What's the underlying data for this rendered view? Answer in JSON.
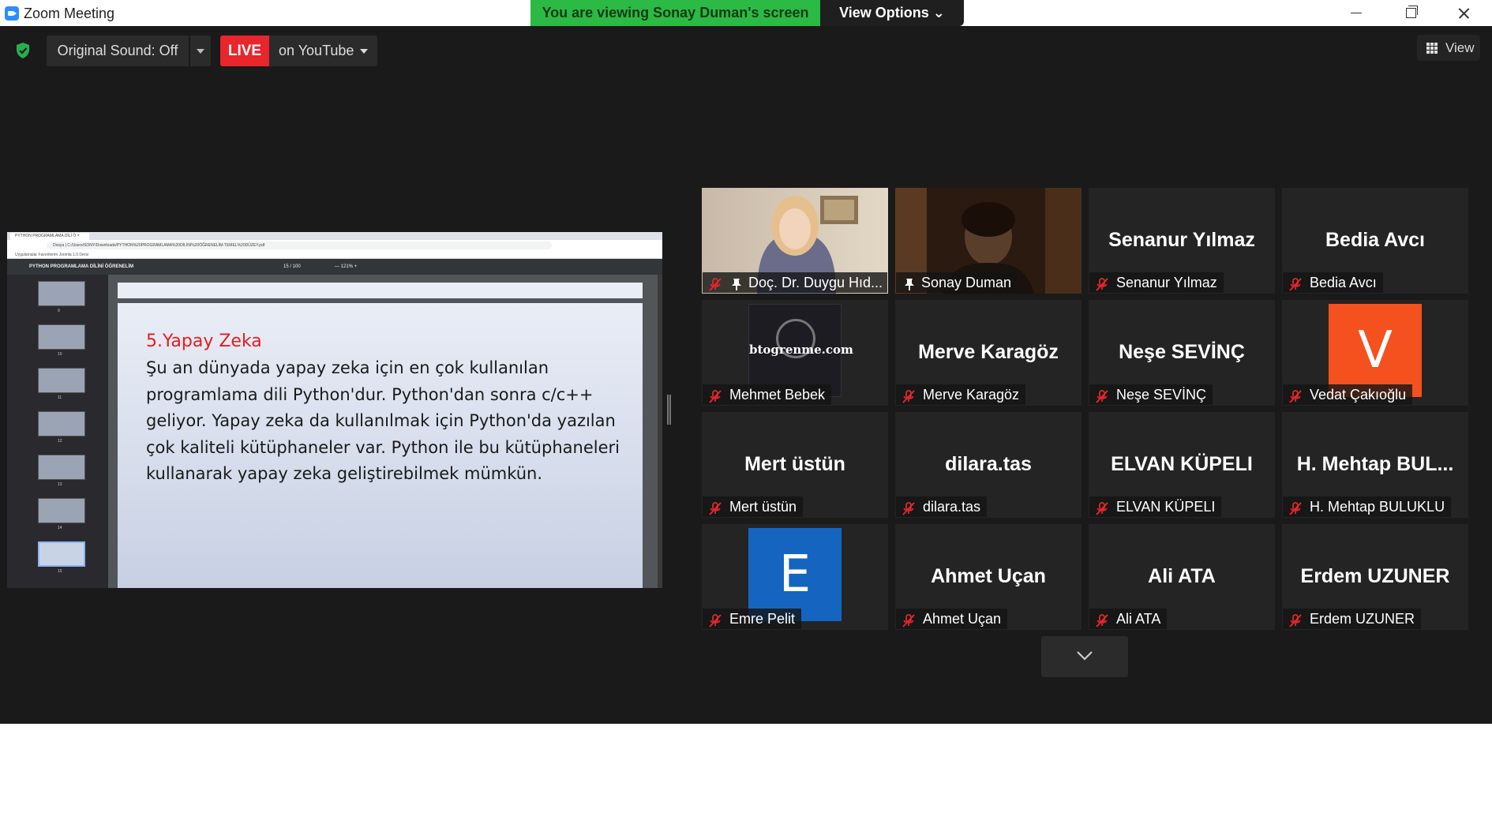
{
  "window": {
    "title": "Zoom Meeting",
    "share_banner": "You are viewing Sonay Duman's screen",
    "view_options": "View Options ⌄"
  },
  "toolbar": {
    "original_sound": "Original Sound: Off",
    "live": "LIVE",
    "on_youtube": "on YouTube",
    "view": "View"
  },
  "shared_screen": {
    "browser_tab": "PYTHON PROGRAMLAMA DİLİ Ö ×",
    "url": "Dosya | C:/Users/SONY/Downloads/PYTHON%20PROGRAMLAMA%20DİLİNİ%20ÖĞRENELİM-TEMEL%20DÜZEY.pdf",
    "bookmarks": "Uygulamalar   Favorilerim   Joomla 1.5 Dersi",
    "pdf_title": "PYTHON PROGRAMLAMA DİLİNİ ÖĞRENELİM",
    "pdf_pages": "15 / 100",
    "pdf_zoom": "—  121%  +",
    "thumb_numbers": [
      "9",
      "10",
      "11",
      "12",
      "13",
      "14",
      "15"
    ],
    "slide_heading": "5.Yapay Zeka",
    "slide_body": "Şu an dünyada yapay zeka için en çok kullanılan programlama dili Python'dur. Python'dan sonra c/c++ geliyor. Yapay zeka da kullanılmak için Python'da yazılan çok kaliteli kütüphaneler var. Python ile bu kütüphaneleri kullanarak yapay zeka geliştirebilmek mümkün."
  },
  "participants": [
    {
      "label": "Doç. Dr. Duygu Hıd...",
      "muted": true,
      "pinned": true,
      "type": "video-female"
    },
    {
      "label": "Sonay Duman",
      "muted": false,
      "pinned": true,
      "type": "video-dark",
      "active": true
    },
    {
      "label": "Senanur Yılmaz",
      "big": "Senanur Yılmaz",
      "muted": true,
      "type": "name"
    },
    {
      "label": "Bedia Avcı",
      "big": "Bedia Avcı",
      "muted": true,
      "type": "name"
    },
    {
      "label": "Mehmet Bebek",
      "muted": true,
      "type": "logo",
      "logo_text": "btogrenme.com"
    },
    {
      "label": "Merve Karagöz",
      "big": "Merve Karagöz",
      "muted": true,
      "type": "name"
    },
    {
      "label": "Neşe SEVİNÇ",
      "big": "Neşe SEVİNÇ",
      "muted": true,
      "type": "name"
    },
    {
      "label": "Vedat Çakıoğlu",
      "muted": true,
      "type": "letter",
      "letter": "V",
      "color": "#f4511e"
    },
    {
      "label": "Mert üstün",
      "big": "Mert üstün",
      "muted": true,
      "type": "name"
    },
    {
      "label": "dilara.tas",
      "big": "dilara.tas",
      "muted": true,
      "type": "name"
    },
    {
      "label": "ELVAN KÜPELI",
      "big": "ELVAN KÜPELI",
      "muted": true,
      "type": "name"
    },
    {
      "label": "H. Mehtap BULUKLU",
      "big": "H. Mehtap BUL...",
      "muted": true,
      "type": "name"
    },
    {
      "label": "Emre Pelit",
      "muted": true,
      "type": "letter",
      "letter": "E",
      "color": "#1565c0"
    },
    {
      "label": "Ahmet Uçan",
      "big": "Ahmet Uçan",
      "muted": true,
      "type": "name"
    },
    {
      "label": "Ali ATA",
      "big": "Ali ATA",
      "muted": true,
      "type": "name"
    },
    {
      "label": "Erdem UZUNER",
      "big": "Erdem UZUNER",
      "muted": true,
      "type": "name"
    }
  ],
  "icons": {
    "shield": "shield-check-icon",
    "mic": "mic-muted-icon",
    "pin": "pin-icon",
    "grid": "grid-icon",
    "chevron": "chevron-down-icon"
  },
  "colors": {
    "banner_green": "#2bba44",
    "live_red": "#e8262c",
    "active_speaker": "#d8e35a",
    "mute_red": "#e02828"
  }
}
